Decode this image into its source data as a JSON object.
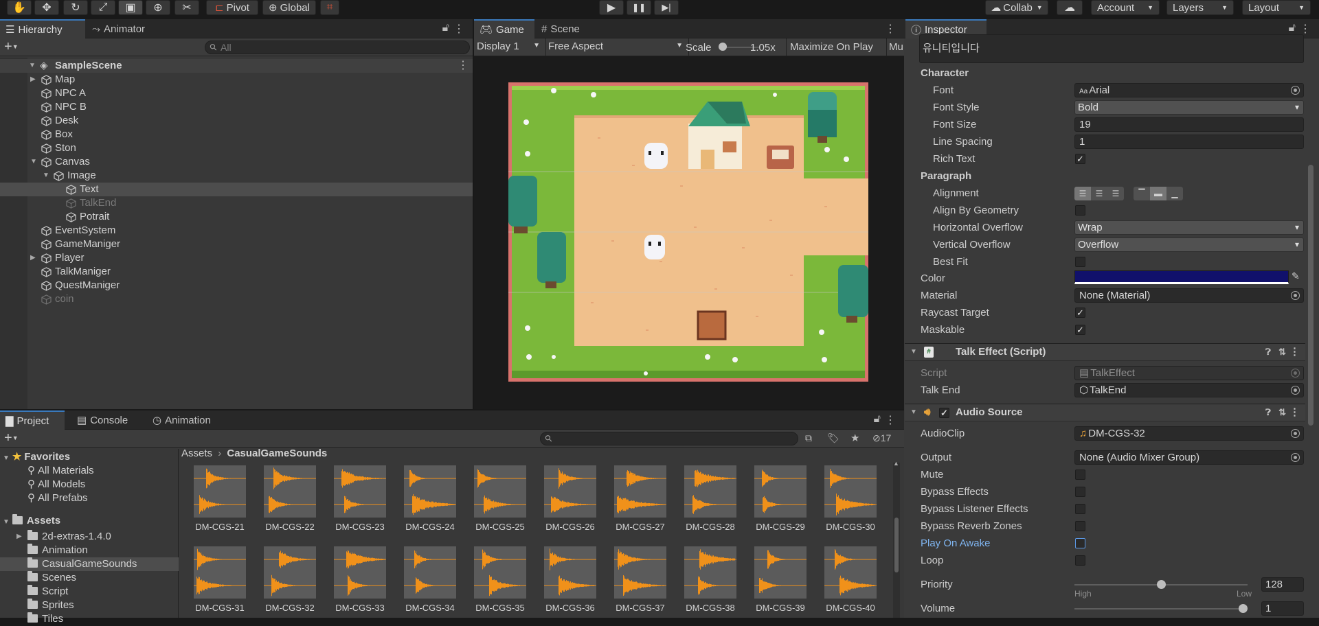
{
  "toolbar": {
    "pivot": "Pivot",
    "global": "Global",
    "collab": "Collab",
    "account": "Account",
    "layers": "Layers",
    "layout": "Layout"
  },
  "hierarchy": {
    "tabs": [
      "Hierarchy",
      "Animator"
    ],
    "search_placeholder": "All",
    "scene": "SampleScene",
    "items": [
      {
        "label": "Map",
        "depth": 1,
        "expandable": true,
        "expanded": false,
        "selected": false,
        "disabled": false
      },
      {
        "label": "NPC A",
        "depth": 1,
        "expandable": false,
        "expanded": false,
        "selected": false,
        "disabled": false
      },
      {
        "label": "NPC B",
        "depth": 1,
        "expandable": false,
        "expanded": false,
        "selected": false,
        "disabled": false
      },
      {
        "label": "Desk",
        "depth": 1,
        "expandable": false,
        "expanded": false,
        "selected": false,
        "disabled": false
      },
      {
        "label": "Box",
        "depth": 1,
        "expandable": false,
        "expanded": false,
        "selected": false,
        "disabled": false
      },
      {
        "label": "Ston",
        "depth": 1,
        "expandable": false,
        "expanded": false,
        "selected": false,
        "disabled": false
      },
      {
        "label": "Canvas",
        "depth": 1,
        "expandable": true,
        "expanded": true,
        "selected": false,
        "disabled": false
      },
      {
        "label": "Image",
        "depth": 2,
        "expandable": true,
        "expanded": true,
        "selected": false,
        "disabled": false
      },
      {
        "label": "Text",
        "depth": 3,
        "expandable": false,
        "expanded": false,
        "selected": true,
        "disabled": false
      },
      {
        "label": "TalkEnd",
        "depth": 3,
        "expandable": false,
        "expanded": false,
        "selected": false,
        "disabled": true
      },
      {
        "label": "Potrait",
        "depth": 3,
        "expandable": false,
        "expanded": false,
        "selected": false,
        "disabled": false
      },
      {
        "label": "EventSystem",
        "depth": 1,
        "expandable": false,
        "expanded": false,
        "selected": false,
        "disabled": false
      },
      {
        "label": "GameManiger",
        "depth": 1,
        "expandable": false,
        "expanded": false,
        "selected": false,
        "disabled": false
      },
      {
        "label": "Player",
        "depth": 1,
        "expandable": true,
        "expanded": false,
        "selected": false,
        "disabled": false
      },
      {
        "label": "TalkManiger",
        "depth": 1,
        "expandable": false,
        "expanded": false,
        "selected": false,
        "disabled": false
      },
      {
        "label": "QuestManiger",
        "depth": 1,
        "expandable": false,
        "expanded": false,
        "selected": false,
        "disabled": false
      },
      {
        "label": "coin",
        "depth": 1,
        "expandable": false,
        "expanded": false,
        "selected": false,
        "disabled": true
      }
    ]
  },
  "game": {
    "tabs": [
      "Game",
      "Scene"
    ],
    "display": "Display 1",
    "aspect": "Free Aspect",
    "scale_label": "Scale",
    "scale_value": "1.05x",
    "maximize": "Maximize On Play",
    "mute": "Mu"
  },
  "project": {
    "tabs": [
      "Project",
      "Console",
      "Animation"
    ],
    "hidden_count": "17",
    "favorites_label": "Favorites",
    "favorites": [
      "All Materials",
      "All Models",
      "All Prefabs"
    ],
    "assets_label": "Assets",
    "folders": [
      {
        "label": "2d-extras-1.4.0",
        "expandable": true,
        "selected": false
      },
      {
        "label": "Animation",
        "expandable": false,
        "selected": false
      },
      {
        "label": "CasualGameSounds",
        "expandable": false,
        "selected": true
      },
      {
        "label": "Scenes",
        "expandable": false,
        "selected": false
      },
      {
        "label": "Script",
        "expandable": false,
        "selected": false
      },
      {
        "label": "Sprites",
        "expandable": false,
        "selected": false
      },
      {
        "label": "Tiles",
        "expandable": false,
        "selected": false
      }
    ],
    "breadcrumb": [
      "Assets",
      "CasualGameSounds"
    ],
    "files": [
      "DM-CGS-21",
      "DM-CGS-22",
      "DM-CGS-23",
      "DM-CGS-24",
      "DM-CGS-25",
      "DM-CGS-26",
      "DM-CGS-27",
      "DM-CGS-28",
      "DM-CGS-29",
      "DM-CGS-30",
      "DM-CGS-31",
      "DM-CGS-32",
      "DM-CGS-33",
      "DM-CGS-34",
      "DM-CGS-35",
      "DM-CGS-36",
      "DM-CGS-37",
      "DM-CGS-38",
      "DM-CGS-39",
      "DM-CGS-40"
    ]
  },
  "inspector": {
    "tab": "Inspector",
    "text_preview": "유니티입니다",
    "character_header": "Character",
    "font_label": "Font",
    "font_value": "Arial",
    "font_style_label": "Font Style",
    "font_style_value": "Bold",
    "font_size_label": "Font Size",
    "font_size_value": "19",
    "line_spacing_label": "Line Spacing",
    "line_spacing_value": "1",
    "rich_text_label": "Rich Text",
    "rich_text_checked": true,
    "paragraph_header": "Paragraph",
    "alignment_label": "Alignment",
    "align_geometry_label": "Align By Geometry",
    "align_geometry_checked": false,
    "h_overflow_label": "Horizontal Overflow",
    "h_overflow_value": "Wrap",
    "v_overflow_label": "Vertical Overflow",
    "v_overflow_value": "Overflow",
    "best_fit_label": "Best Fit",
    "best_fit_checked": false,
    "color_label": "Color",
    "color_value": "#11116b",
    "material_label": "Material",
    "material_value": "None (Material)",
    "raycast_label": "Raycast Target",
    "raycast_checked": true,
    "maskable_label": "Maskable",
    "maskable_checked": true,
    "talk_effect_header": "Talk Effect (Script)",
    "script_label": "Script",
    "script_value": "TalkEffect",
    "talk_end_label": "Talk End",
    "talk_end_value": "TalkEnd",
    "audio_header": "Audio Source",
    "audioclip_label": "AudioClip",
    "audioclip_value": "DM-CGS-32",
    "output_label": "Output",
    "output_value": "None (Audio Mixer Group)",
    "mute_label": "Mute",
    "bypass_effects_label": "Bypass Effects",
    "bypass_listener_label": "Bypass Listener Effects",
    "bypass_reverb_label": "Bypass Reverb Zones",
    "play_on_awake_label": "Play On Awake",
    "loop_label": "Loop",
    "priority_label": "Priority",
    "priority_value": "128",
    "priority_level": 0.5,
    "priority_high": "High",
    "priority_low": "Low",
    "volume_label": "Volume",
    "volume_value": "1",
    "volume_level": 1.0
  },
  "colors": {
    "accent": "#3a79bb",
    "orange_wave": "#f0911a",
    "panel": "#383838"
  }
}
